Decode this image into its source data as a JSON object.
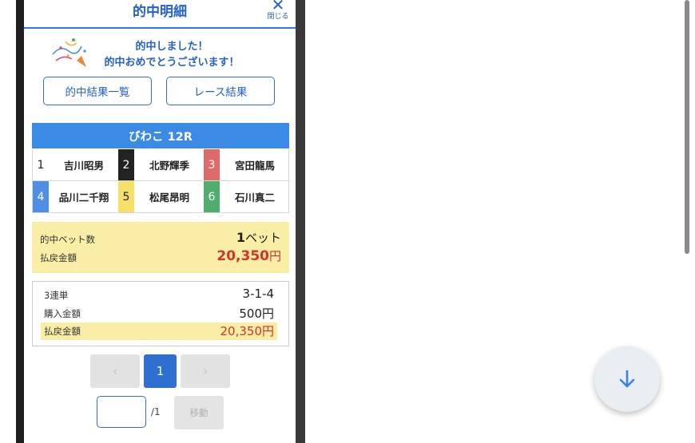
{
  "header": {
    "title": "的中明細",
    "close_label": "閉じる"
  },
  "congrats": {
    "line1": "的中しました！",
    "line2": "的中おめでとうございます！",
    "icon": "party-popper-icon"
  },
  "buttons": {
    "hit_list": "的中結果一覧",
    "race_result": "レース結果"
  },
  "race": {
    "title": "びわこ 12R",
    "racers": [
      {
        "num": "1",
        "name": "吉川昭男",
        "bg": "#ffffff",
        "fg": "#222222"
      },
      {
        "num": "2",
        "name": "北野輝季",
        "bg": "#222222",
        "fg": "#ffffff"
      },
      {
        "num": "3",
        "name": "宮田龍馬",
        "bg": "#e06a6a",
        "fg": "#ffffff"
      },
      {
        "num": "4",
        "name": "品川二千翔",
        "bg": "#4f8ee6",
        "fg": "#ffffff"
      },
      {
        "num": "5",
        "name": "松尾昂明",
        "bg": "#f5e16a",
        "fg": "#222222"
      },
      {
        "num": "6",
        "name": "石川真二",
        "bg": "#4fae6e",
        "fg": "#ffffff"
      }
    ]
  },
  "summary": {
    "bets_label": "的中ベット数",
    "bets_num": "1",
    "bets_unit": "ベット",
    "payout_label": "払戻金額",
    "payout_num": "20,350",
    "payout_unit": "円"
  },
  "detail": {
    "bet_type": "3連単",
    "combination": "3-1-4",
    "purchase_label": "購入金額",
    "purchase_value": "500円",
    "payout_label": "払戻金額",
    "payout_value": "20,350円"
  },
  "pager": {
    "prev": "‹",
    "current": "1",
    "next": "›",
    "total": "/1",
    "move": "移動"
  },
  "colors": {
    "accent": "#2461c8",
    "highlight": "#faeea7",
    "payout_red": "#d93025"
  },
  "fab": {
    "icon": "arrow-down-icon"
  }
}
